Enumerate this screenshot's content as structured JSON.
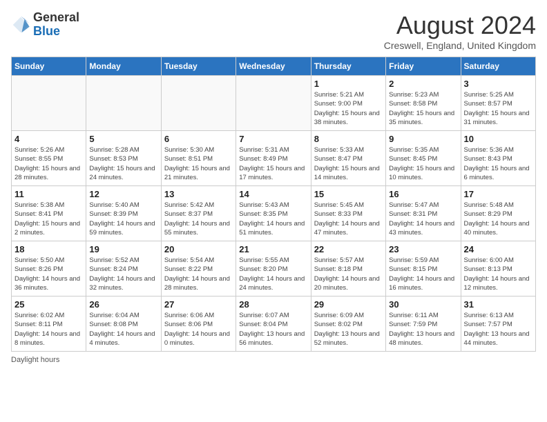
{
  "header": {
    "logo_general": "General",
    "logo_blue": "Blue",
    "title": "August 2024",
    "location": "Creswell, England, United Kingdom"
  },
  "footer": {
    "note": "Daylight hours"
  },
  "days_of_week": [
    "Sunday",
    "Monday",
    "Tuesday",
    "Wednesday",
    "Thursday",
    "Friday",
    "Saturday"
  ],
  "weeks": [
    [
      {
        "day": "",
        "sunrise": "",
        "sunset": "",
        "daylight": ""
      },
      {
        "day": "",
        "sunrise": "",
        "sunset": "",
        "daylight": ""
      },
      {
        "day": "",
        "sunrise": "",
        "sunset": "",
        "daylight": ""
      },
      {
        "day": "",
        "sunrise": "",
        "sunset": "",
        "daylight": ""
      },
      {
        "day": "1",
        "sunrise": "Sunrise: 5:21 AM",
        "sunset": "Sunset: 9:00 PM",
        "daylight": "Daylight: 15 hours and 38 minutes."
      },
      {
        "day": "2",
        "sunrise": "Sunrise: 5:23 AM",
        "sunset": "Sunset: 8:58 PM",
        "daylight": "Daylight: 15 hours and 35 minutes."
      },
      {
        "day": "3",
        "sunrise": "Sunrise: 5:25 AM",
        "sunset": "Sunset: 8:57 PM",
        "daylight": "Daylight: 15 hours and 31 minutes."
      }
    ],
    [
      {
        "day": "4",
        "sunrise": "Sunrise: 5:26 AM",
        "sunset": "Sunset: 8:55 PM",
        "daylight": "Daylight: 15 hours and 28 minutes."
      },
      {
        "day": "5",
        "sunrise": "Sunrise: 5:28 AM",
        "sunset": "Sunset: 8:53 PM",
        "daylight": "Daylight: 15 hours and 24 minutes."
      },
      {
        "day": "6",
        "sunrise": "Sunrise: 5:30 AM",
        "sunset": "Sunset: 8:51 PM",
        "daylight": "Daylight: 15 hours and 21 minutes."
      },
      {
        "day": "7",
        "sunrise": "Sunrise: 5:31 AM",
        "sunset": "Sunset: 8:49 PM",
        "daylight": "Daylight: 15 hours and 17 minutes."
      },
      {
        "day": "8",
        "sunrise": "Sunrise: 5:33 AM",
        "sunset": "Sunset: 8:47 PM",
        "daylight": "Daylight: 15 hours and 14 minutes."
      },
      {
        "day": "9",
        "sunrise": "Sunrise: 5:35 AM",
        "sunset": "Sunset: 8:45 PM",
        "daylight": "Daylight: 15 hours and 10 minutes."
      },
      {
        "day": "10",
        "sunrise": "Sunrise: 5:36 AM",
        "sunset": "Sunset: 8:43 PM",
        "daylight": "Daylight: 15 hours and 6 minutes."
      }
    ],
    [
      {
        "day": "11",
        "sunrise": "Sunrise: 5:38 AM",
        "sunset": "Sunset: 8:41 PM",
        "daylight": "Daylight: 15 hours and 2 minutes."
      },
      {
        "day": "12",
        "sunrise": "Sunrise: 5:40 AM",
        "sunset": "Sunset: 8:39 PM",
        "daylight": "Daylight: 14 hours and 59 minutes."
      },
      {
        "day": "13",
        "sunrise": "Sunrise: 5:42 AM",
        "sunset": "Sunset: 8:37 PM",
        "daylight": "Daylight: 14 hours and 55 minutes."
      },
      {
        "day": "14",
        "sunrise": "Sunrise: 5:43 AM",
        "sunset": "Sunset: 8:35 PM",
        "daylight": "Daylight: 14 hours and 51 minutes."
      },
      {
        "day": "15",
        "sunrise": "Sunrise: 5:45 AM",
        "sunset": "Sunset: 8:33 PM",
        "daylight": "Daylight: 14 hours and 47 minutes."
      },
      {
        "day": "16",
        "sunrise": "Sunrise: 5:47 AM",
        "sunset": "Sunset: 8:31 PM",
        "daylight": "Daylight: 14 hours and 43 minutes."
      },
      {
        "day": "17",
        "sunrise": "Sunrise: 5:48 AM",
        "sunset": "Sunset: 8:29 PM",
        "daylight": "Daylight: 14 hours and 40 minutes."
      }
    ],
    [
      {
        "day": "18",
        "sunrise": "Sunrise: 5:50 AM",
        "sunset": "Sunset: 8:26 PM",
        "daylight": "Daylight: 14 hours and 36 minutes."
      },
      {
        "day": "19",
        "sunrise": "Sunrise: 5:52 AM",
        "sunset": "Sunset: 8:24 PM",
        "daylight": "Daylight: 14 hours and 32 minutes."
      },
      {
        "day": "20",
        "sunrise": "Sunrise: 5:54 AM",
        "sunset": "Sunset: 8:22 PM",
        "daylight": "Daylight: 14 hours and 28 minutes."
      },
      {
        "day": "21",
        "sunrise": "Sunrise: 5:55 AM",
        "sunset": "Sunset: 8:20 PM",
        "daylight": "Daylight: 14 hours and 24 minutes."
      },
      {
        "day": "22",
        "sunrise": "Sunrise: 5:57 AM",
        "sunset": "Sunset: 8:18 PM",
        "daylight": "Daylight: 14 hours and 20 minutes."
      },
      {
        "day": "23",
        "sunrise": "Sunrise: 5:59 AM",
        "sunset": "Sunset: 8:15 PM",
        "daylight": "Daylight: 14 hours and 16 minutes."
      },
      {
        "day": "24",
        "sunrise": "Sunrise: 6:00 AM",
        "sunset": "Sunset: 8:13 PM",
        "daylight": "Daylight: 14 hours and 12 minutes."
      }
    ],
    [
      {
        "day": "25",
        "sunrise": "Sunrise: 6:02 AM",
        "sunset": "Sunset: 8:11 PM",
        "daylight": "Daylight: 14 hours and 8 minutes."
      },
      {
        "day": "26",
        "sunrise": "Sunrise: 6:04 AM",
        "sunset": "Sunset: 8:08 PM",
        "daylight": "Daylight: 14 hours and 4 minutes."
      },
      {
        "day": "27",
        "sunrise": "Sunrise: 6:06 AM",
        "sunset": "Sunset: 8:06 PM",
        "daylight": "Daylight: 14 hours and 0 minutes."
      },
      {
        "day": "28",
        "sunrise": "Sunrise: 6:07 AM",
        "sunset": "Sunset: 8:04 PM",
        "daylight": "Daylight: 13 hours and 56 minutes."
      },
      {
        "day": "29",
        "sunrise": "Sunrise: 6:09 AM",
        "sunset": "Sunset: 8:02 PM",
        "daylight": "Daylight: 13 hours and 52 minutes."
      },
      {
        "day": "30",
        "sunrise": "Sunrise: 6:11 AM",
        "sunset": "Sunset: 7:59 PM",
        "daylight": "Daylight: 13 hours and 48 minutes."
      },
      {
        "day": "31",
        "sunrise": "Sunrise: 6:13 AM",
        "sunset": "Sunset: 7:57 PM",
        "daylight": "Daylight: 13 hours and 44 minutes."
      }
    ]
  ]
}
